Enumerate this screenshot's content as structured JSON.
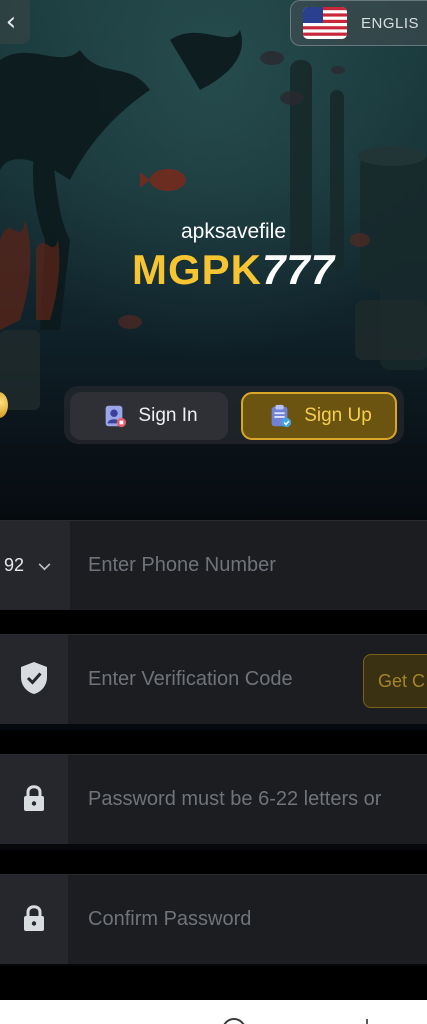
{
  "header": {
    "back_icon": "chevron-left-icon",
    "language": {
      "flag": "us-flag-icon",
      "label": "ENGLIS"
    }
  },
  "branding": {
    "watermark": "apksavefile",
    "logo_part1": "MGPK",
    "logo_part2": "777"
  },
  "tabs": [
    {
      "label": "Sign In",
      "icon": "user-badge-icon",
      "active": false
    },
    {
      "label": "Sign Up",
      "icon": "clipboard-check-icon",
      "active": true
    }
  ],
  "form": {
    "phone": {
      "country_code": "92",
      "placeholder": "Enter Phone Number"
    },
    "verification": {
      "placeholder": "Enter Verification Code",
      "button_label": "Get C"
    },
    "password": {
      "placeholder": "Password must be 6-22 letters or"
    },
    "confirm_password": {
      "placeholder": "Confirm Password"
    }
  },
  "colors": {
    "accent_gold": "#f6c531",
    "signup_bg": "#6b5410",
    "field_bg": "#1c1d21"
  }
}
